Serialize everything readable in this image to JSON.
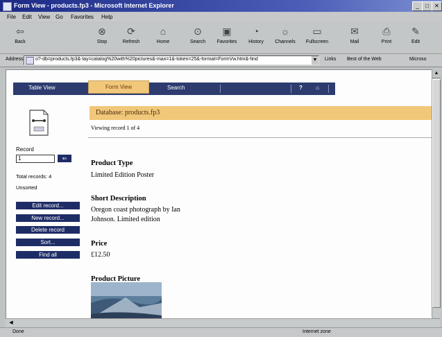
{
  "window": {
    "title": "Form View - products.fp3 - Microsoft Internet Explorer",
    "controls": [
      "_",
      "□",
      "✕"
    ]
  },
  "menu": [
    "File",
    "Edit",
    "View",
    "Go",
    "Favorites",
    "Help"
  ],
  "toolbar": [
    {
      "label": "Back",
      "icon": "back-arrow-icon",
      "glyph": "⇦"
    },
    {
      "label": "Stop",
      "icon": "stop-icon",
      "glyph": "⊗"
    },
    {
      "label": "Refresh",
      "icon": "refresh-icon",
      "glyph": "⟳"
    },
    {
      "label": "Home",
      "icon": "home-icon",
      "glyph": "⌂"
    },
    {
      "label": "Search",
      "icon": "search-icon",
      "glyph": "⊙"
    },
    {
      "label": "Favorites",
      "icon": "favorites-icon",
      "glyph": "▣"
    },
    {
      "label": "History",
      "icon": "history-icon",
      "glyph": "◔"
    },
    {
      "label": "Channels",
      "icon": "channels-icon",
      "glyph": "☼"
    },
    {
      "label": "Fullscreen",
      "icon": "fullscreen-icon",
      "glyph": "▭"
    },
    {
      "label": "Mail",
      "icon": "mail-icon",
      "glyph": "✉"
    },
    {
      "label": "Print",
      "icon": "print-icon",
      "glyph": "⎙"
    },
    {
      "label": "Edit",
      "icon": "edit-icon",
      "glyph": "✎"
    }
  ],
  "address": {
    "label": "Address",
    "url": "o?-db=products.fp3&-lay=catalog%20with%20pictures&-max=1&-token=25&-format=FormVw.htm&-find",
    "links_label": "Links",
    "links": [
      "Best of the Web",
      "Microso"
    ]
  },
  "page": {
    "tabs": {
      "table": "Table View",
      "form": "Form View",
      "search": "Search"
    },
    "help": "?",
    "home": "⌂",
    "record_label": "Record",
    "record_value": "1",
    "go": "⇐",
    "total_records": "Total records: 4",
    "sort_state": "Unsorted",
    "buttons": [
      "Edit record...",
      "New record...",
      "Delete record",
      "Sort...",
      "Find all"
    ],
    "db_title": "Database: products.fp3",
    "viewing": "Viewing record 1 of 4",
    "fields": [
      {
        "label": "Product Type",
        "value": "Limited Edition Poster"
      },
      {
        "label": "Short Description",
        "value_lines": [
          "Oregon coast photograph by Ian",
          "Johnson. Limited edition"
        ]
      },
      {
        "label": "Price",
        "value": "£12.50"
      },
      {
        "label": "Product Picture"
      }
    ]
  },
  "status": {
    "left": "Done",
    "right": "Internet zone"
  },
  "colors": {
    "nav": "#2d3b6f",
    "accent": "#f1c77a",
    "button": "#1e2c66"
  }
}
